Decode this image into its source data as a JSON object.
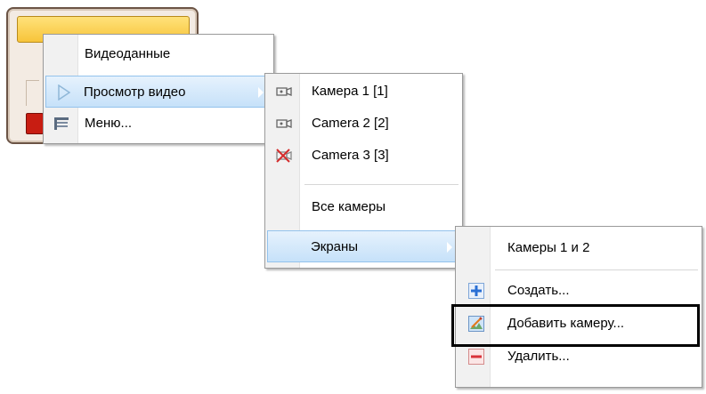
{
  "menu1": {
    "items": [
      {
        "label": "Видеоданные"
      },
      {
        "label": "Просмотр видео"
      },
      {
        "label": "Меню..."
      }
    ]
  },
  "menu2": {
    "items": [
      {
        "label": "Камера 1 [1]"
      },
      {
        "label": "Camera 2 [2]"
      },
      {
        "label": "Camera 3 [3]"
      },
      {
        "label": "Все камеры"
      },
      {
        "label": "Экраны"
      }
    ]
  },
  "menu3": {
    "items": [
      {
        "label": "Камеры 1 и 2"
      },
      {
        "label": "Создать..."
      },
      {
        "label": "Добавить камеру..."
      },
      {
        "label": "Удалить..."
      }
    ]
  },
  "icons": {
    "play": "play-triangle-icon",
    "menu": "menu-icon",
    "camera": "camera-icon",
    "camera_disabled": "camera-disabled-icon",
    "add": "plus-icon",
    "edit": "edit-image-icon",
    "delete": "minus-icon"
  },
  "colors": {
    "highlight": "#c6e1f9",
    "highlight_border": "#93c2ec",
    "plus": "#2a6fd4",
    "minus": "#d9333a"
  }
}
